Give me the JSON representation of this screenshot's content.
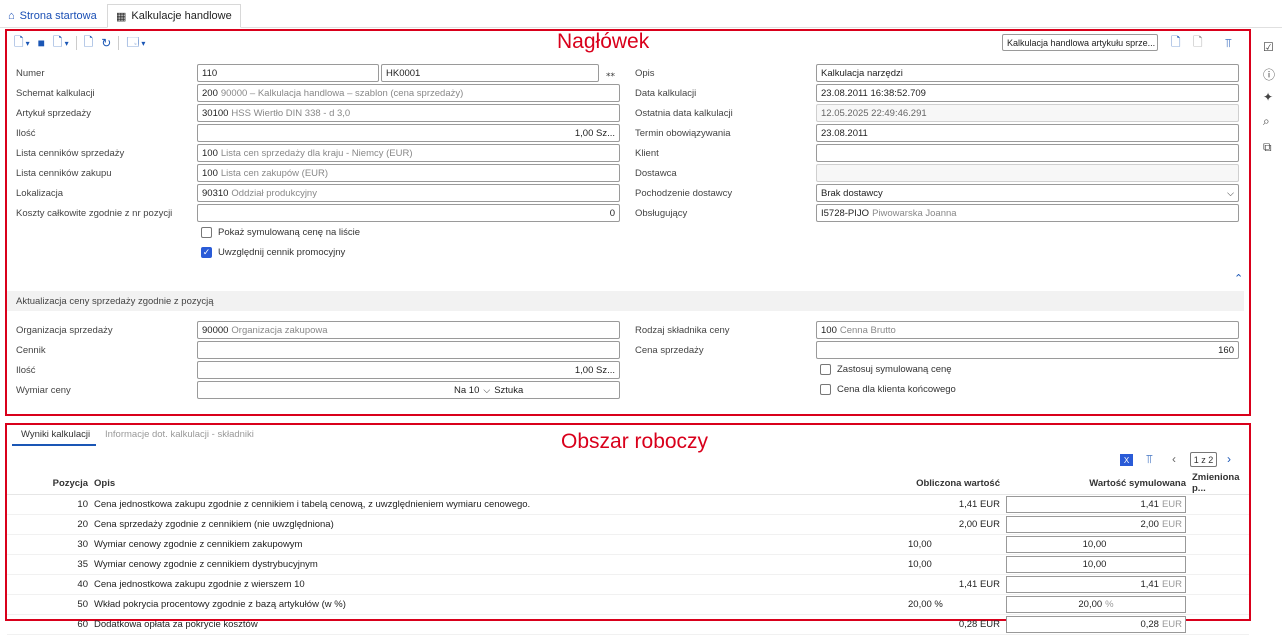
{
  "tabs": {
    "home": "Strona startowa",
    "active": "Kalkulacje handlowe"
  },
  "annotations": {
    "header": "Nagłówek",
    "work": "Obszar roboczy"
  },
  "toolbar": {
    "icons": [
      "new-document-icon",
      "chevron-down-icon",
      "save-icon",
      "discard-icon",
      "chevron-down-icon",
      "copy-icon",
      "refresh-icon",
      "print-icon",
      "chevron-down-icon"
    ],
    "right_input": "Kalkulacja handlowa artykułu sprze..."
  },
  "header": {
    "numer_label": "Numer",
    "numer_a": "110",
    "numer_b": "HK0001",
    "schemat_label": "Schemat kalkulacji",
    "schemat_code": "200",
    "schemat_desc": "90000 – Kalkulacja handlowa – szablon (cena sprzedaży)",
    "artykul_label": "Artykuł sprzedaży",
    "artykul_code": "30100",
    "artykul_desc": "HSS Wiertło DIN 338 - d 3,0",
    "ilosc_label": "Ilość",
    "ilosc_val": "1,00 Sz...",
    "lista_sprz_label": "Lista cenników sprzedaży",
    "lista_sprz_code": "100",
    "lista_sprz_desc": "Lista cen sprzedaży dla kraju - Niemcy (EUR)",
    "lista_zak_label": "Lista cenników zakupu",
    "lista_zak_code": "100",
    "lista_zak_desc": "Lista cen zakupów (EUR)",
    "lokal_label": "Lokalizacja",
    "lokal_code": "90310",
    "lokal_desc": "Oddział produkcyjny",
    "koszty_label": "Koszty całkowite zgodnie z nr pozycji",
    "koszty_val": "0",
    "pokaz_label": "Pokaż symulowaną cenę na liście",
    "uwzgl_label": "Uwzględnij cennik promocyjny",
    "opis_label": "Opis",
    "opis_val": "Kalkulacja narzędzi",
    "data_label": "Data kalkulacji",
    "data_val": "23.08.2011  16:38:52.709",
    "ost_label": "Ostatnia data kalkulacji",
    "ost_val": "12.05.2025  22:49:46.291",
    "termin_label": "Termin obowiązywania",
    "termin_val": "23.08.2011",
    "klient_label": "Klient",
    "klient_val": "",
    "dostawca_label": "Dostawca",
    "dostawca_val": "",
    "pochodz_label": "Pochodzenie dostawcy",
    "pochodz_val": "Brak dostawcy",
    "obsl_label": "Obsługujący",
    "obsl_code": "I5728-PIJO",
    "obsl_desc": "Piwowarska Joanna"
  },
  "aktualizacja": {
    "title": "Aktualizacja ceny sprzedaży zgodnie z pozycją",
    "org_label": "Organizacja sprzedaży",
    "org_code": "90000",
    "org_desc": "Organizacja zakupowa",
    "cennik_label": "Cennik",
    "cennik_val": "",
    "ilosc_label": "Ilość",
    "ilosc_val": "1,00 Sz...",
    "wymiar_label": "Wymiar ceny",
    "wymiar_val": "Na 10",
    "wymiar_unit": "Sztuka",
    "rodzaj_label": "Rodzaj składnika ceny",
    "rodzaj_code": "100",
    "rodzaj_desc": "Cenna Brutto",
    "cena_label": "Cena sprzedaży",
    "cena_val": "160",
    "zastosuj_label": "Zastosuj symulowaną cenę",
    "klient_konc_label": "Cena dla klienta końcowego"
  },
  "work": {
    "tabs": [
      "Wyniki kalkulacji",
      "Informacje dot. kalkulacji - składniki"
    ],
    "pager": "1 z 2",
    "columns": {
      "poz": "Pozycja",
      "opis": "Opis",
      "oblicz": "Obliczona wartość",
      "sym": "Wartość symulowana",
      "zmien": "Zmieniona p..."
    },
    "rows": [
      {
        "poz": "10",
        "opis": "Cena jednostkowa zakupu zgodnie z cennikiem i tabelą cenową, z uwzględnieniem wymiaru cenowego.",
        "oblicz": "1,41 EUR",
        "sym": "1,41",
        "sym_unit": "EUR"
      },
      {
        "poz": "20",
        "opis": "Cena sprzedaży zgodnie z cennikiem (nie uwzględniona)",
        "oblicz": "2,00 EUR",
        "sym": "2,00",
        "sym_unit": "EUR"
      },
      {
        "poz": "30",
        "opis": "Wymiar cenowy zgodnie z cennikiem zakupowym",
        "oblicz": "10,00",
        "sym": "10,00",
        "sym_unit": ""
      },
      {
        "poz": "35",
        "opis": "Wymiar cenowy zgodnie z cennikiem dystrybucyjnym",
        "oblicz": "10,00",
        "sym": "10,00",
        "sym_unit": ""
      },
      {
        "poz": "40",
        "opis": "Cena jednostkowa zakupu zgodnie z wierszem 10",
        "oblicz": "1,41 EUR",
        "sym": "1,41",
        "sym_unit": "EUR"
      },
      {
        "poz": "50",
        "opis": "Wkład pokrycia procentowy zgodnie z bazą artykułów (w %)",
        "oblicz": "20,00 %",
        "sym": "20,00",
        "sym_unit": "%"
      },
      {
        "poz": "60",
        "opis": "Dodatkowa opłata za pokrycie kosztów",
        "oblicz": "0,28 EUR",
        "sym": "0,28",
        "sym_unit": "EUR"
      }
    ]
  },
  "colors": {
    "accent": "#1a56b5",
    "annotation": "#d9001b"
  }
}
